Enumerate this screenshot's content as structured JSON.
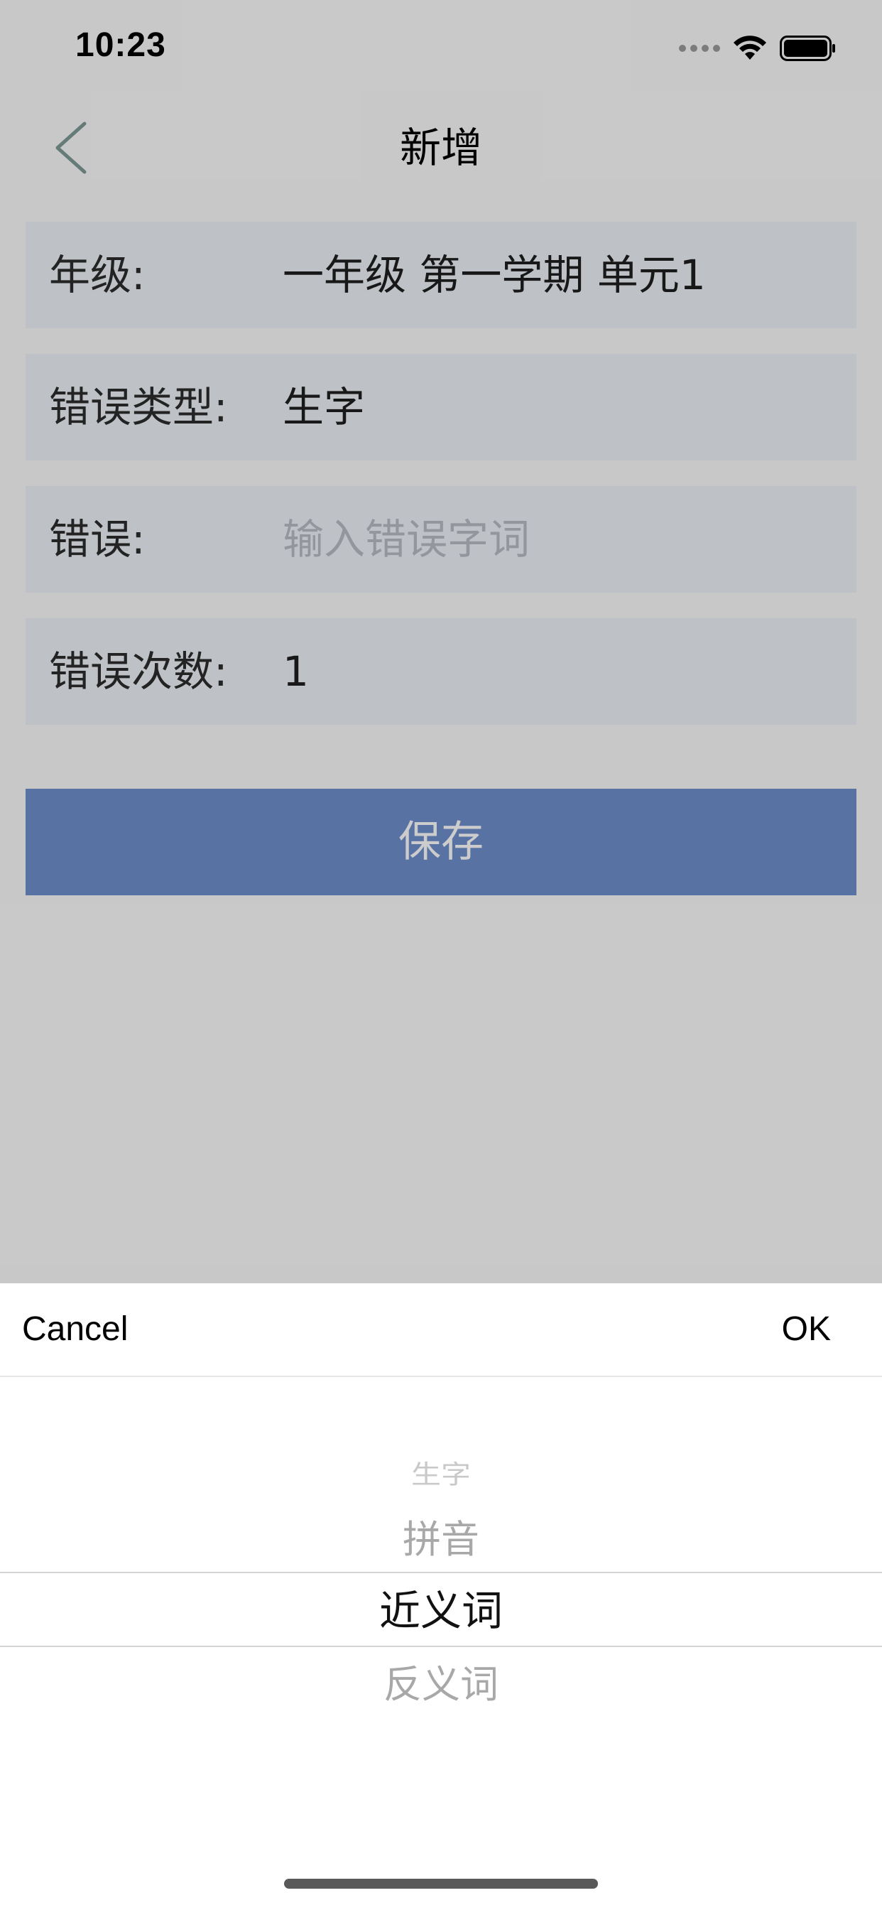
{
  "status_bar": {
    "time": "10:23"
  },
  "nav": {
    "title": "新增"
  },
  "form": {
    "grade": {
      "label": "年级:",
      "value": "一年级 第一学期 单元1"
    },
    "error_type": {
      "label": "错误类型:",
      "value": "生字"
    },
    "error": {
      "label": "错误:",
      "value": "",
      "placeholder": "输入错误字词"
    },
    "error_count": {
      "label": "错误次数:",
      "value": "1"
    }
  },
  "save_button": {
    "label": "保存"
  },
  "picker": {
    "cancel_label": "Cancel",
    "ok_label": "OK",
    "options": [
      "生字",
      "拼音",
      "近义词",
      "反义词"
    ],
    "selected": "近义词"
  },
  "colors": {
    "accent": "#6e8fcc",
    "row_background": "#eef2f8"
  }
}
